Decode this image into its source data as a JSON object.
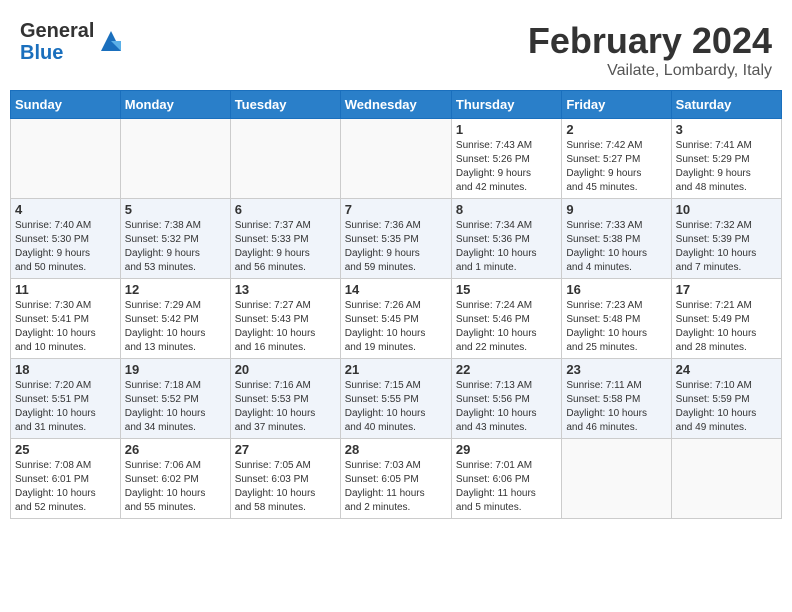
{
  "logo": {
    "general": "General",
    "blue": "Blue"
  },
  "title": "February 2024",
  "location": "Vailate, Lombardy, Italy",
  "weekdays": [
    "Sunday",
    "Monday",
    "Tuesday",
    "Wednesday",
    "Thursday",
    "Friday",
    "Saturday"
  ],
  "weeks": [
    [
      {
        "day": "",
        "info": ""
      },
      {
        "day": "",
        "info": ""
      },
      {
        "day": "",
        "info": ""
      },
      {
        "day": "",
        "info": ""
      },
      {
        "day": "1",
        "info": "Sunrise: 7:43 AM\nSunset: 5:26 PM\nDaylight: 9 hours\nand 42 minutes."
      },
      {
        "day": "2",
        "info": "Sunrise: 7:42 AM\nSunset: 5:27 PM\nDaylight: 9 hours\nand 45 minutes."
      },
      {
        "day": "3",
        "info": "Sunrise: 7:41 AM\nSunset: 5:29 PM\nDaylight: 9 hours\nand 48 minutes."
      }
    ],
    [
      {
        "day": "4",
        "info": "Sunrise: 7:40 AM\nSunset: 5:30 PM\nDaylight: 9 hours\nand 50 minutes."
      },
      {
        "day": "5",
        "info": "Sunrise: 7:38 AM\nSunset: 5:32 PM\nDaylight: 9 hours\nand 53 minutes."
      },
      {
        "day": "6",
        "info": "Sunrise: 7:37 AM\nSunset: 5:33 PM\nDaylight: 9 hours\nand 56 minutes."
      },
      {
        "day": "7",
        "info": "Sunrise: 7:36 AM\nSunset: 5:35 PM\nDaylight: 9 hours\nand 59 minutes."
      },
      {
        "day": "8",
        "info": "Sunrise: 7:34 AM\nSunset: 5:36 PM\nDaylight: 10 hours\nand 1 minute."
      },
      {
        "day": "9",
        "info": "Sunrise: 7:33 AM\nSunset: 5:38 PM\nDaylight: 10 hours\nand 4 minutes."
      },
      {
        "day": "10",
        "info": "Sunrise: 7:32 AM\nSunset: 5:39 PM\nDaylight: 10 hours\nand 7 minutes."
      }
    ],
    [
      {
        "day": "11",
        "info": "Sunrise: 7:30 AM\nSunset: 5:41 PM\nDaylight: 10 hours\nand 10 minutes."
      },
      {
        "day": "12",
        "info": "Sunrise: 7:29 AM\nSunset: 5:42 PM\nDaylight: 10 hours\nand 13 minutes."
      },
      {
        "day": "13",
        "info": "Sunrise: 7:27 AM\nSunset: 5:43 PM\nDaylight: 10 hours\nand 16 minutes."
      },
      {
        "day": "14",
        "info": "Sunrise: 7:26 AM\nSunset: 5:45 PM\nDaylight: 10 hours\nand 19 minutes."
      },
      {
        "day": "15",
        "info": "Sunrise: 7:24 AM\nSunset: 5:46 PM\nDaylight: 10 hours\nand 22 minutes."
      },
      {
        "day": "16",
        "info": "Sunrise: 7:23 AM\nSunset: 5:48 PM\nDaylight: 10 hours\nand 25 minutes."
      },
      {
        "day": "17",
        "info": "Sunrise: 7:21 AM\nSunset: 5:49 PM\nDaylight: 10 hours\nand 28 minutes."
      }
    ],
    [
      {
        "day": "18",
        "info": "Sunrise: 7:20 AM\nSunset: 5:51 PM\nDaylight: 10 hours\nand 31 minutes."
      },
      {
        "day": "19",
        "info": "Sunrise: 7:18 AM\nSunset: 5:52 PM\nDaylight: 10 hours\nand 34 minutes."
      },
      {
        "day": "20",
        "info": "Sunrise: 7:16 AM\nSunset: 5:53 PM\nDaylight: 10 hours\nand 37 minutes."
      },
      {
        "day": "21",
        "info": "Sunrise: 7:15 AM\nSunset: 5:55 PM\nDaylight: 10 hours\nand 40 minutes."
      },
      {
        "day": "22",
        "info": "Sunrise: 7:13 AM\nSunset: 5:56 PM\nDaylight: 10 hours\nand 43 minutes."
      },
      {
        "day": "23",
        "info": "Sunrise: 7:11 AM\nSunset: 5:58 PM\nDaylight: 10 hours\nand 46 minutes."
      },
      {
        "day": "24",
        "info": "Sunrise: 7:10 AM\nSunset: 5:59 PM\nDaylight: 10 hours\nand 49 minutes."
      }
    ],
    [
      {
        "day": "25",
        "info": "Sunrise: 7:08 AM\nSunset: 6:01 PM\nDaylight: 10 hours\nand 52 minutes."
      },
      {
        "day": "26",
        "info": "Sunrise: 7:06 AM\nSunset: 6:02 PM\nDaylight: 10 hours\nand 55 minutes."
      },
      {
        "day": "27",
        "info": "Sunrise: 7:05 AM\nSunset: 6:03 PM\nDaylight: 10 hours\nand 58 minutes."
      },
      {
        "day": "28",
        "info": "Sunrise: 7:03 AM\nSunset: 6:05 PM\nDaylight: 11 hours\nand 2 minutes."
      },
      {
        "day": "29",
        "info": "Sunrise: 7:01 AM\nSunset: 6:06 PM\nDaylight: 11 hours\nand 5 minutes."
      },
      {
        "day": "",
        "info": ""
      },
      {
        "day": "",
        "info": ""
      }
    ]
  ]
}
